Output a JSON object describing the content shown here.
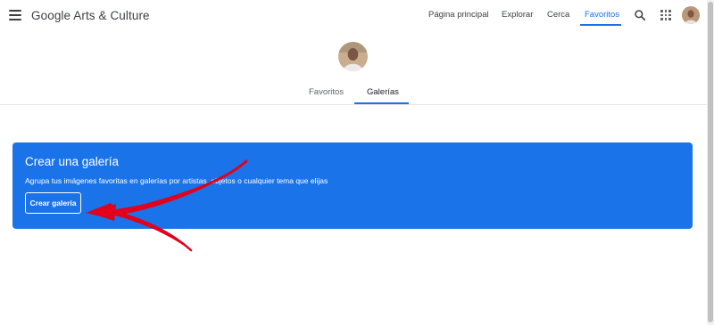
{
  "header": {
    "logo": "Google Arts & Culture",
    "nav": [
      {
        "label": "Página principal",
        "active": false
      },
      {
        "label": "Explorar",
        "active": false
      },
      {
        "label": "Cerca",
        "active": false
      },
      {
        "label": "Favoritos",
        "active": true
      }
    ]
  },
  "profile": {
    "tabs": [
      {
        "label": "Favoritos",
        "active": false
      },
      {
        "label": "Galerías",
        "active": true
      }
    ]
  },
  "banner": {
    "title": "Crear una galería",
    "subtitle": "Agrupa tus imágenes favoritas en galerías por artistas, objetos o cualquier tema que elijas",
    "button_label": "Crear galería"
  },
  "colors": {
    "accent": "#1a73e8",
    "annotation_arrow": "#e3001b"
  },
  "icons": [
    "menu-icon",
    "search-icon",
    "apps-icon",
    "avatar"
  ]
}
